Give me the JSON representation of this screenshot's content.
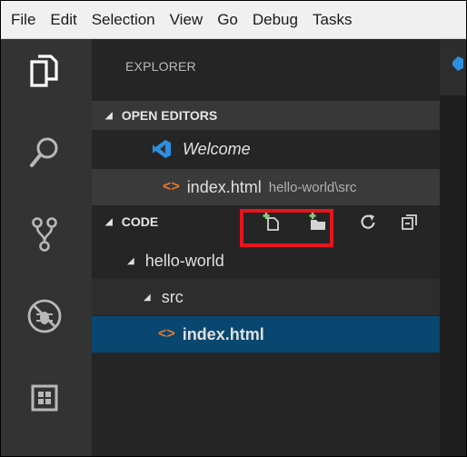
{
  "menu": [
    "File",
    "Edit",
    "Selection",
    "View",
    "Go",
    "Debug",
    "Tasks"
  ],
  "activity_bar": {
    "icons": [
      "files-icon",
      "search-icon",
      "source-control-icon",
      "debug-icon",
      "extensions-icon"
    ]
  },
  "explorer": {
    "title": "EXPLORER",
    "open_editors": {
      "header": "OPEN EDITORS",
      "items": [
        {
          "label": "Welcome",
          "icon": "vscode-logo-icon"
        },
        {
          "label": "index.html",
          "path": "hello-world\\src",
          "icon": "html-file-icon"
        }
      ]
    },
    "folder": {
      "header": "CODE",
      "actions": [
        "new-file-icon",
        "new-folder-icon",
        "refresh-icon",
        "collapse-all-icon"
      ],
      "tree": [
        {
          "label": "hello-world",
          "depth": 1,
          "expanded": true
        },
        {
          "label": "src",
          "depth": 2,
          "expanded": true
        },
        {
          "label": "index.html",
          "depth": 3,
          "selected": true,
          "icon": "html-file-icon"
        }
      ]
    }
  },
  "colors": {
    "activity_bg": "#333333",
    "sidebar_bg": "#252526",
    "selection": "#094771",
    "html_icon": "#e37933",
    "highlight_box": "#e8141b"
  }
}
